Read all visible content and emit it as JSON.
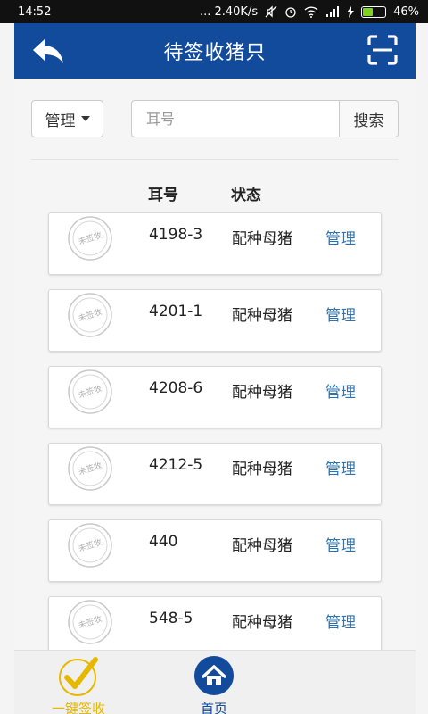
{
  "status_bar": {
    "time": "14:52",
    "network_speed": "... 2.40K/s",
    "battery_text": "46%",
    "battery_level": 0.46,
    "icons": [
      "mute-icon",
      "alarm-icon",
      "wifi-icon",
      "signal-icon",
      "charging-icon"
    ]
  },
  "header": {
    "title": "待签收猪只",
    "back_icon": "back-arrow-icon",
    "scan_icon": "scan-icon"
  },
  "toolbar": {
    "manage_label": "管理",
    "search_placeholder": "耳号",
    "search_value": "",
    "search_button": "搜索"
  },
  "table": {
    "columns": [
      "耳号",
      "状态"
    ],
    "rows": [
      {
        "stamp": "未签收",
        "ear": "4198-3",
        "status": "配种母猪",
        "action": "管理"
      },
      {
        "stamp": "未签收",
        "ear": "4201-1",
        "status": "配种母猪",
        "action": "管理"
      },
      {
        "stamp": "未签收",
        "ear": "4208-6",
        "status": "配种母猪",
        "action": "管理"
      },
      {
        "stamp": "未签收",
        "ear": "4212-5",
        "status": "配种母猪",
        "action": "管理"
      },
      {
        "stamp": "未签收",
        "ear": "440",
        "status": "配种母猪",
        "action": "管理"
      },
      {
        "stamp": "未签收",
        "ear": "548-5",
        "status": "配种母猪",
        "action": "管理"
      }
    ]
  },
  "bottom_nav": {
    "sign_all_label": "一键签收",
    "home_label": "首页",
    "colors": {
      "sign": "#e6b800",
      "home": "#124a9c"
    }
  },
  "colors": {
    "header_bg": "#124a9c",
    "link": "#2a74b5",
    "status_bar_bg": "#111111"
  }
}
